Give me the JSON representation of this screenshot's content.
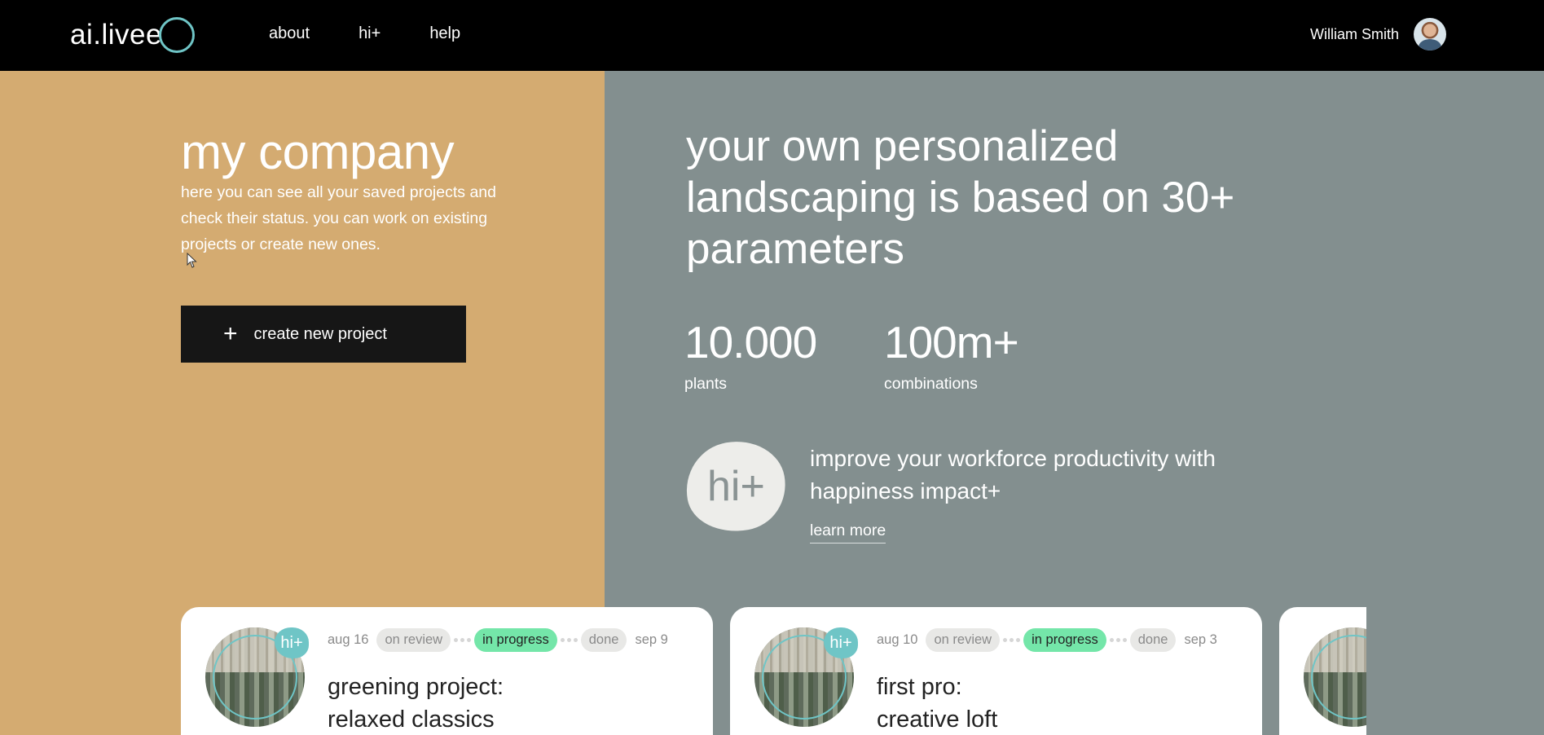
{
  "nav": {
    "logo_text": "ai.livee",
    "links": [
      "about",
      "hi+",
      "help"
    ],
    "user_name": "William Smith",
    "logo_ring_color": "#6fc5c6"
  },
  "intro": {
    "title": "my company",
    "description": "here you can see all your saved projects and check their status. you can work on existing projects or create new ones.",
    "create_button": "create new project",
    "create_icon": "+"
  },
  "hero": {
    "tagline": "your own personalized landscaping is based on 30+ parameters",
    "stats": [
      {
        "value": "10.000",
        "label": "plants"
      },
      {
        "value": "100m+",
        "label": "combinations"
      }
    ],
    "promo_badge": "hi+",
    "promo_text": "improve your workforce productivity with happiness impact+",
    "learn_more": "learn more"
  },
  "projects": [
    {
      "badge": "hi+",
      "start_date": "aug 16",
      "statuses": [
        "on review",
        "in progress",
        "done"
      ],
      "active_status": "in progress",
      "end_date": "sep 9",
      "title_line1": "greening project:",
      "title_line2": "relaxed classics"
    },
    {
      "badge": "hi+",
      "start_date": "aug 10",
      "statuses": [
        "on review",
        "in progress",
        "done"
      ],
      "active_status": "in progress",
      "end_date": "sep 3",
      "title_line1": "first pro:",
      "title_line2": "creative loft"
    }
  ],
  "colors": {
    "left_panel": "#d4ab71",
    "right_panel": "#838f8f",
    "accent": "#6fc5c6",
    "status_active": "#74e6a9"
  }
}
